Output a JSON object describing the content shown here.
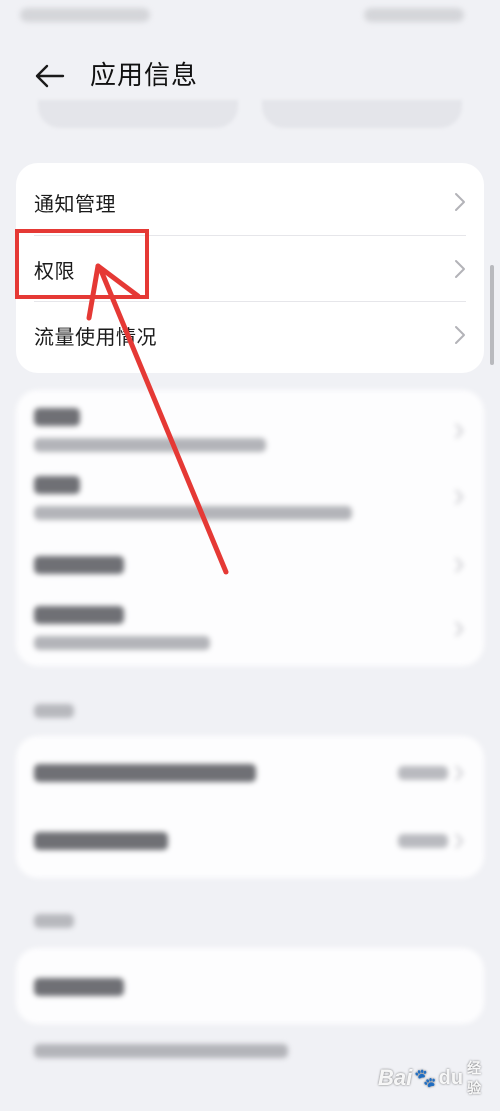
{
  "header": {
    "title": "应用信息"
  },
  "primary_card": {
    "items": [
      {
        "label": "通知管理"
      },
      {
        "label": "权限"
      },
      {
        "label": "流量使用情况"
      }
    ]
  },
  "annotation": {
    "highlight_color": "#e53935",
    "arrow_color": "#e53935"
  },
  "watermark": {
    "text_bai": "Bai",
    "text_du": "du",
    "text_jingyan": "经验"
  }
}
